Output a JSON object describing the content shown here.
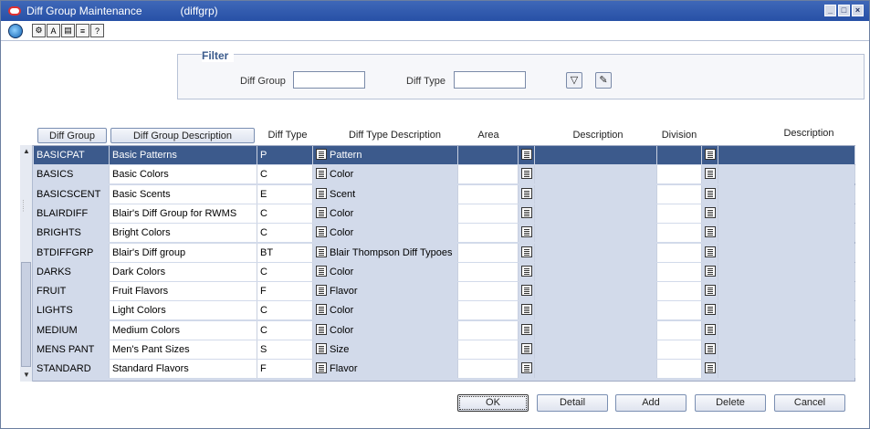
{
  "window": {
    "title": "Diff Group Maintenance",
    "code": "(diffgrp)",
    "controls": [
      "minimize",
      "maximize",
      "close"
    ]
  },
  "toolbar": {
    "icons": [
      "globe-icon",
      "help-icon",
      "spell-icon",
      "notes-icon",
      "print-icon",
      "question-icon"
    ]
  },
  "filter": {
    "title": "Filter",
    "diff_group_label": "Diff Group",
    "diff_group_value": "",
    "diff_type_label": "Diff Type",
    "diff_type_value": ""
  },
  "table": {
    "headers": {
      "diff_group": "Diff Group",
      "diff_group_description": "Diff Group Description",
      "diff_type": "Diff Type",
      "diff_type_description": "Diff Type Description",
      "area": "Area",
      "area_description": "Description",
      "division": "Division",
      "division_description": "Description"
    },
    "rows": [
      {
        "group": "BASICPAT",
        "desc": "Basic Patterns",
        "type": "P",
        "tdesc": "Pattern",
        "selected": true
      },
      {
        "group": "BASICS",
        "desc": "Basic Colors",
        "type": "C",
        "tdesc": "Color"
      },
      {
        "group": "BASICSCENT",
        "desc": "Basic Scents",
        "type": "E",
        "tdesc": "Scent"
      },
      {
        "group": "BLAIRDIFF",
        "desc": "Blair's Diff Group for RWMS",
        "type": "C",
        "tdesc": "Color"
      },
      {
        "group": "BRIGHTS",
        "desc": "Bright Colors",
        "type": "C",
        "tdesc": "Color"
      },
      {
        "group": "BTDIFFGRP",
        "desc": "Blair's Diff group",
        "type": "BT",
        "tdesc": "Blair Thompson Diff Typoes"
      },
      {
        "group": "DARKS",
        "desc": "Dark Colors",
        "type": "C",
        "tdesc": "Color"
      },
      {
        "group": "FRUIT",
        "desc": "Fruit Flavors",
        "type": "F",
        "tdesc": "Flavor"
      },
      {
        "group": "LIGHTS",
        "desc": "Light Colors",
        "type": "C",
        "tdesc": "Color"
      },
      {
        "group": "MEDIUM",
        "desc": "Medium Colors",
        "type": "C",
        "tdesc": "Color"
      },
      {
        "group": "MENS PANT",
        "desc": "Men's Pant Sizes",
        "type": "S",
        "tdesc": "Size"
      },
      {
        "group": "STANDARD",
        "desc": "Standard Flavors",
        "type": "F",
        "tdesc": "Flavor"
      }
    ]
  },
  "buttons": {
    "ok": "OK",
    "detail": "Detail",
    "add": "Add",
    "delete": "Delete",
    "cancel": "Cancel"
  },
  "colors": {
    "title_bar": "#2f5aae",
    "selected_row": "#3c5a8c",
    "grid_bg": "#d2daea"
  }
}
